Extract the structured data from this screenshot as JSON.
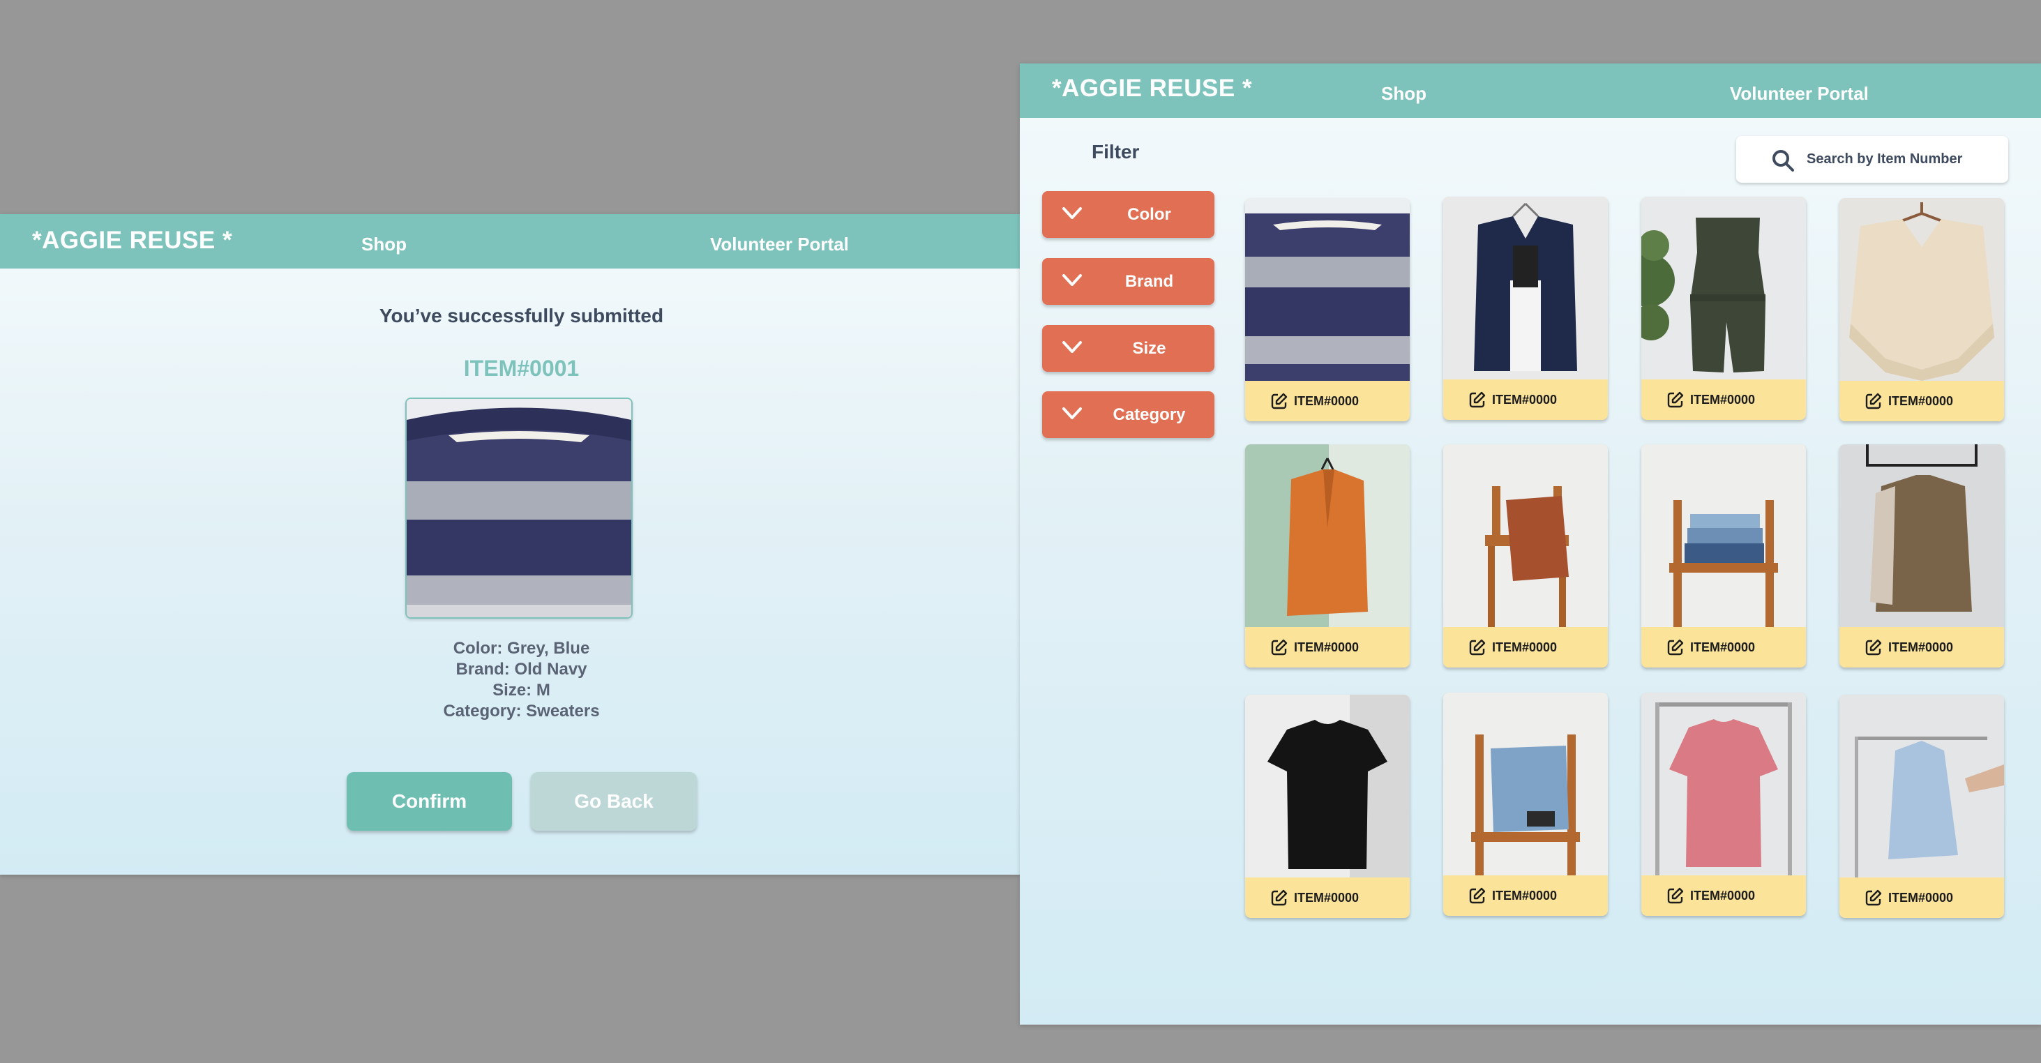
{
  "left_screen": {
    "header": {
      "logo": "*AGGIE REUSE *",
      "nav_shop": "Shop",
      "nav_volunteer": "Volunteer Portal"
    },
    "title": "You’ve successfully submitted",
    "item_number": "ITEM#0001",
    "details": {
      "color": "Color: Grey, Blue",
      "brand": "Brand: Old Navy",
      "size": "Size: M",
      "category": "Category: Sweaters"
    },
    "buttons": {
      "confirm": "Confirm",
      "go_back": "Go Back"
    }
  },
  "right_screen": {
    "header": {
      "logo": "*AGGIE REUSE *",
      "nav_shop": "Shop",
      "nav_volunteer": "Volunteer Portal"
    },
    "filter_label": "Filter",
    "filters": [
      "Color",
      "Brand",
      "Size",
      "Category"
    ],
    "search_placeholder": "Search by Item Number",
    "items": [
      {
        "code": "ITEM#0000",
        "photo": "striped-sweater"
      },
      {
        "code": "ITEM#0000",
        "photo": "navy-knit-vest"
      },
      {
        "code": "ITEM#0000",
        "photo": "olive-romper"
      },
      {
        "code": "ITEM#0000",
        "photo": "cream-knit-poncho"
      },
      {
        "code": "ITEM#0000",
        "photo": "orange-blazer"
      },
      {
        "code": "ITEM#0000",
        "photo": "rust-sweater-on-chair"
      },
      {
        "code": "ITEM#0000",
        "photo": "folded-jeans-on-chair"
      },
      {
        "code": "ITEM#0000",
        "photo": "khaki-shirt-jacket"
      },
      {
        "code": "ITEM#0000",
        "photo": "black-tshirt"
      },
      {
        "code": "ITEM#0000",
        "photo": "denim-on-chair"
      },
      {
        "code": "ITEM#0000",
        "photo": "pink-tshirt-dress"
      },
      {
        "code": "ITEM#0000",
        "photo": "light-blue-shirt"
      }
    ]
  },
  "colors": {
    "teal": "#7dc3bb",
    "coral": "#e06f54",
    "butter": "#fbe39a",
    "navy_text": "#3e4a5e",
    "backdrop": "#979797"
  }
}
